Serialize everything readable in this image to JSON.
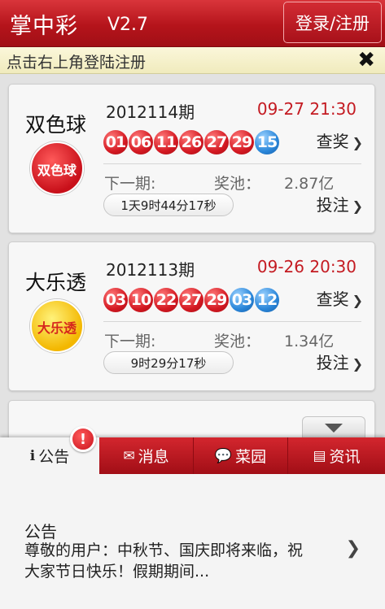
{
  "header": {
    "title": "掌中彩",
    "version": "V2.7",
    "login_label": "登录/注册"
  },
  "hint": {
    "text": "点击右上角登陆注册",
    "close_glyph": "✖"
  },
  "cards": [
    {
      "name": "双色球",
      "logo_text": "双色球",
      "issue": "2012114期",
      "draw_time": "09-27 21:30",
      "balls": [
        {
          "num": "01",
          "color": "red"
        },
        {
          "num": "06",
          "color": "red"
        },
        {
          "num": "11",
          "color": "red"
        },
        {
          "num": "26",
          "color": "red"
        },
        {
          "num": "27",
          "color": "red"
        },
        {
          "num": "29",
          "color": "red"
        },
        {
          "num": "15",
          "color": "blue"
        }
      ],
      "check_label": "查奖",
      "next_label": "下一期:",
      "pool_label": "奖池：",
      "pool_value": "2.87亿",
      "countdown": "1天9时44分17秒",
      "bet_label": "投注"
    },
    {
      "name": "大乐透",
      "logo_text": "大乐透",
      "issue": "2012113期",
      "draw_time": "09-26 20:30",
      "balls": [
        {
          "num": "03",
          "color": "red"
        },
        {
          "num": "10",
          "color": "red"
        },
        {
          "num": "22",
          "color": "red"
        },
        {
          "num": "27",
          "color": "red"
        },
        {
          "num": "29",
          "color": "red"
        },
        {
          "num": "03",
          "color": "blue"
        },
        {
          "num": "12",
          "color": "blue"
        }
      ],
      "check_label": "查奖",
      "next_label": "下一期:",
      "pool_label": "奖池：",
      "pool_value": "1.34亿",
      "countdown": "9时29分17秒",
      "bet_label": "投注"
    }
  ],
  "tabs": [
    {
      "label": "公告",
      "icon": "info-icon",
      "glyph": "ℹ",
      "active": true
    },
    {
      "label": "消息",
      "icon": "envelope-icon",
      "glyph": "✉",
      "active": false
    },
    {
      "label": "菜园",
      "icon": "chat-bubble-icon",
      "glyph": "💬",
      "active": false
    },
    {
      "label": "资讯",
      "icon": "document-icon",
      "glyph": "▤",
      "active": false
    }
  ],
  "badge": "!",
  "notice": {
    "title": "公告",
    "body": "尊敬的用户：中秋节、国庆即将来临，祝大家节日快乐！假期期间..."
  },
  "colors": {
    "brand_red": "#c41b22",
    "ball_red": "#d41922",
    "ball_blue": "#2a86d9"
  }
}
